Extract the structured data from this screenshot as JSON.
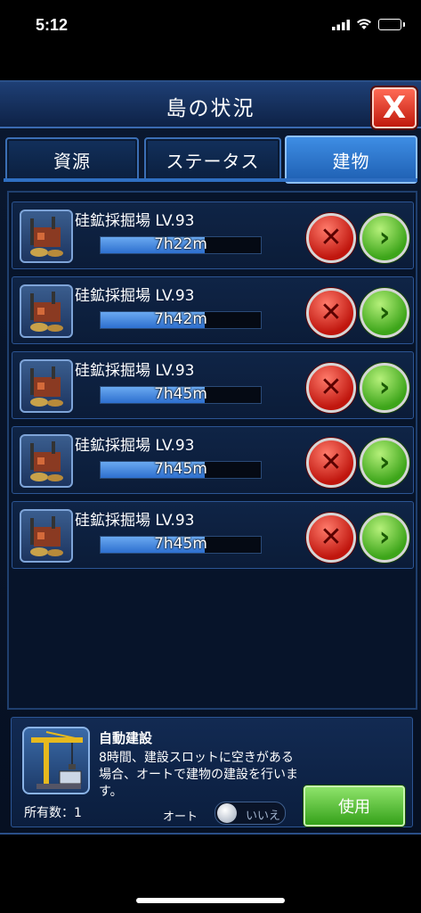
{
  "status_bar": {
    "time": "5:12"
  },
  "window": {
    "title": "島の状況",
    "close_label": "X"
  },
  "tabs": [
    {
      "label": "資源",
      "active": false
    },
    {
      "label": "ステータス",
      "active": false
    },
    {
      "label": "建物",
      "active": true
    }
  ],
  "buildings": [
    {
      "name": "硅鉱採掘場 LV.93",
      "timer": "7h22m",
      "progress": 0.65
    },
    {
      "name": "硅鉱採掘場 LV.93",
      "timer": "7h42m",
      "progress": 0.65
    },
    {
      "name": "硅鉱採掘場 LV.93",
      "timer": "7h45m",
      "progress": 0.65
    },
    {
      "name": "硅鉱採掘場 LV.93",
      "timer": "7h45m",
      "progress": 0.65
    },
    {
      "name": "硅鉱採掘場 LV.93",
      "timer": "7h45m",
      "progress": 0.65
    }
  ],
  "row_buttons": {
    "cancel_icon": "cancel-x-icon",
    "go_icon": "go-arrow-icon"
  },
  "auto_build": {
    "title": "自動建設",
    "description": "8時間、建設スロットに空きがある場合、オートで建物の建設を行います。",
    "owned": "所有数：1",
    "auto_label": "オート",
    "toggle_state": "いいえ",
    "use_button": "使用"
  },
  "colors": {
    "accent": "#1e5fb2",
    "cancel": "#c0160e",
    "go": "#3da51a",
    "use": "#35a11a"
  }
}
